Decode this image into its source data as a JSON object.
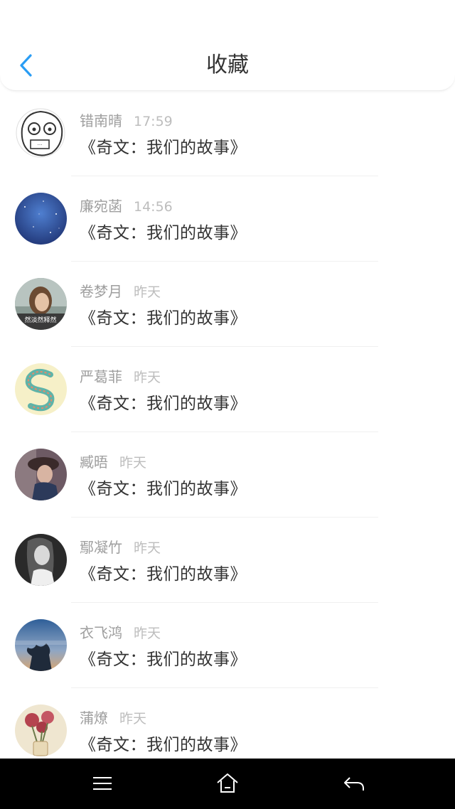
{
  "header": {
    "title": "收藏",
    "back_icon": "chevron-left-icon",
    "accent_color": "#2a9df4"
  },
  "items": [
    {
      "name": "错南晴",
      "time": "17:59",
      "message": "《奇文：我们的故事》",
      "avatar": "cartoon-face"
    },
    {
      "name": "廉宛菡",
      "time": "14:56",
      "message": "《奇文：我们的故事》",
      "avatar": "starry-sky"
    },
    {
      "name": "卷梦月",
      "time": "昨天",
      "message": "《奇文：我们的故事》",
      "avatar": "woman-portrait",
      "avatar_caption": "然淡然释然"
    },
    {
      "name": "严葛菲",
      "time": "昨天",
      "message": "《奇文：我们的故事》",
      "avatar": "letter-s-art"
    },
    {
      "name": "臧晤",
      "time": "昨天",
      "message": "《奇文：我们的故事》",
      "avatar": "girl-hat"
    },
    {
      "name": "鄢凝竹",
      "time": "昨天",
      "message": "《奇文：我们的故事》",
      "avatar": "girl-bw"
    },
    {
      "name": "衣飞鸿",
      "time": "昨天",
      "message": "《奇文：我们的故事》",
      "avatar": "sunset-tree"
    },
    {
      "name": "蒲燎",
      "time": "昨天",
      "message": "《奇文：我们的故事》",
      "avatar": "flowers-vase"
    }
  ],
  "navbar": {
    "menu_icon": "menu-icon",
    "home_icon": "home-icon",
    "back_icon": "back-arrow-icon"
  }
}
